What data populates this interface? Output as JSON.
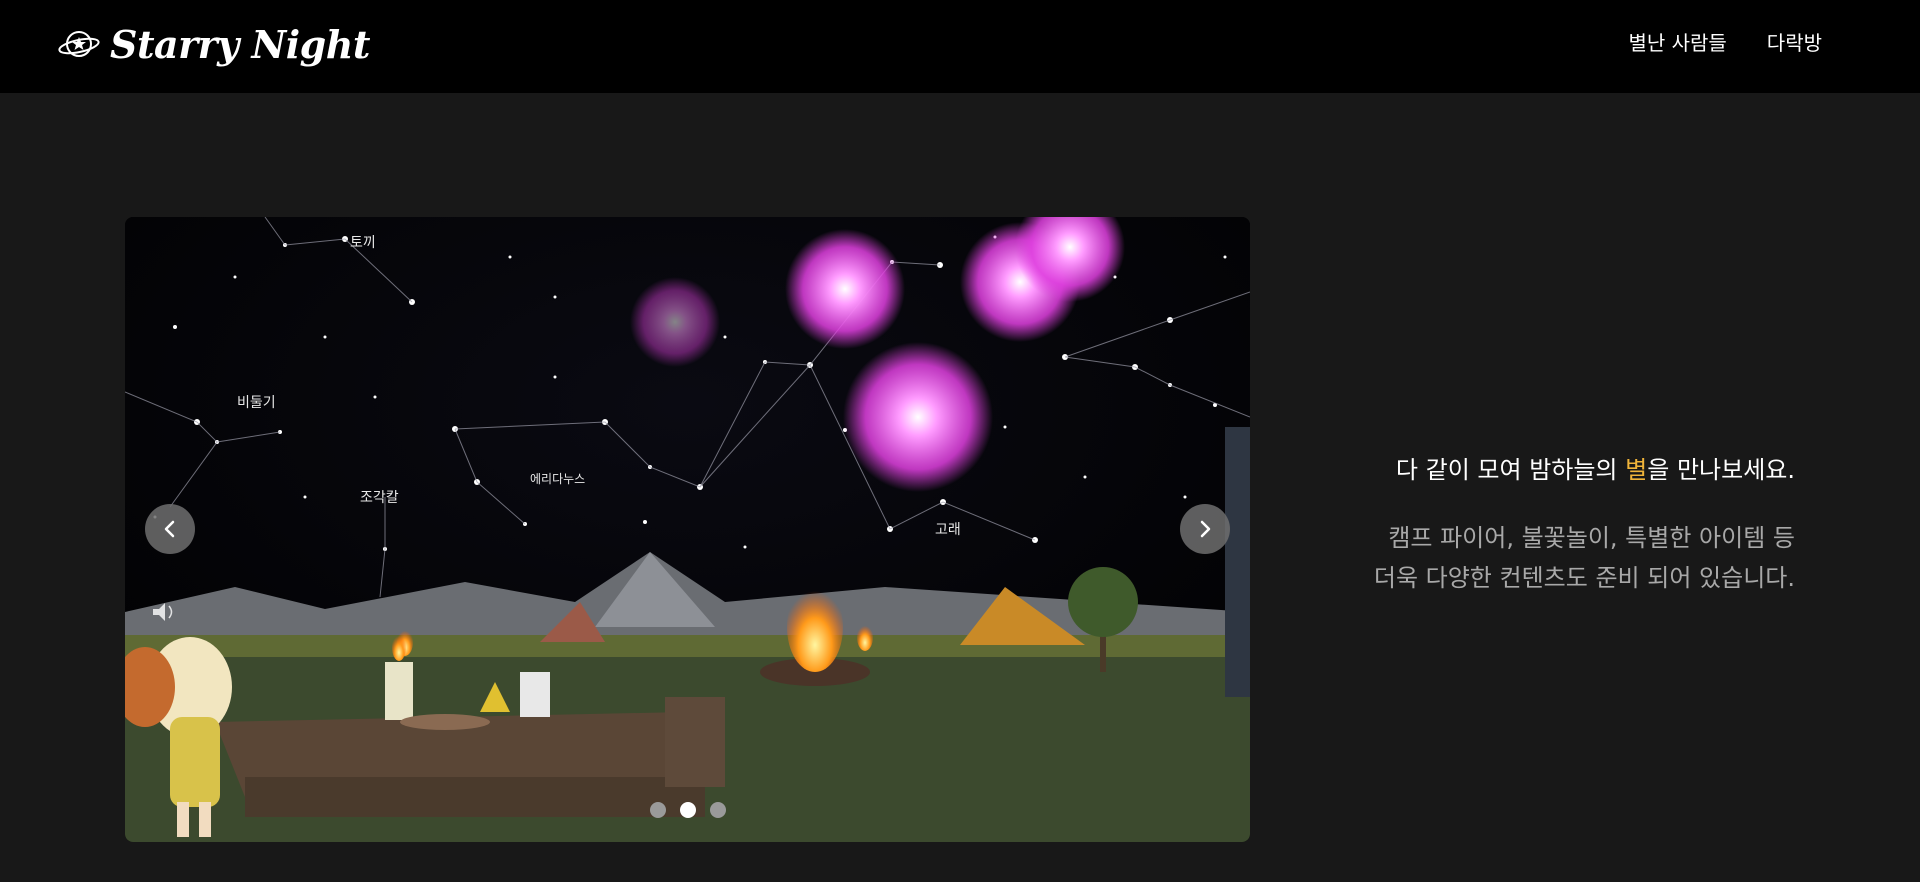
{
  "header": {
    "logo_text": "Starry Night",
    "logo_icon": "planet-star-icon",
    "nav": [
      {
        "label": "별난 사람들"
      },
      {
        "label": "다락방"
      }
    ]
  },
  "carousel": {
    "slide_labels": {
      "rabbit": "토끼",
      "pigeon": "비둘기",
      "sculptor": "조각칼",
      "eridanus": "에리다누스",
      "whale": "고래"
    },
    "prev_icon": "chevron-left-icon",
    "next_icon": "chevron-right-icon",
    "sound_icon": "speaker-icon",
    "dots_count": 3,
    "active_dot": 2
  },
  "main": {
    "headline_before": "다 같이 모여 밤하늘의 ",
    "headline_accent": "별",
    "headline_after": "을 만나보세요.",
    "desc_line1": "캠프 파이어, 불꽃놀이, 특별한 아이템 등",
    "desc_line2": "더욱 다양한 컨텐츠도 준비 되어 있습니다."
  },
  "colors": {
    "header_bg": "#000000",
    "page_bg": "#181818",
    "accent": "#f0b43a",
    "firework": "#e040e0"
  }
}
